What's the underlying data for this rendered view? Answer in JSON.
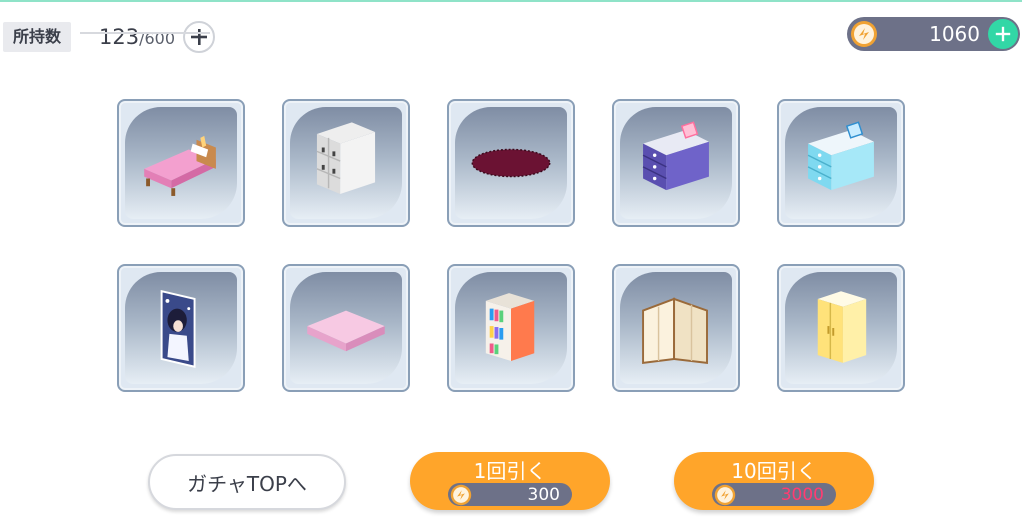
{
  "header": {
    "owned_label": "所持数",
    "owned_current": "123",
    "owned_max": "/600",
    "currency_value": "1060"
  },
  "items": [
    {
      "name": "pink-bed",
      "icon": "bed-icon"
    },
    {
      "name": "white-locker",
      "icon": "locker-icon"
    },
    {
      "name": "oval-rug",
      "icon": "rug-icon"
    },
    {
      "name": "purple-chest",
      "icon": "dresser-icon"
    },
    {
      "name": "blue-chest",
      "icon": "dresser-icon"
    },
    {
      "name": "idol-poster",
      "icon": "poster-icon"
    },
    {
      "name": "pink-mat",
      "icon": "mat-icon"
    },
    {
      "name": "bookshelf",
      "icon": "bookshelf-icon"
    },
    {
      "name": "folding-screen",
      "icon": "screen-icon"
    },
    {
      "name": "yellow-wardrobe",
      "icon": "wardrobe-icon"
    }
  ],
  "buttons": {
    "gacha_top": "ガチャTOPへ",
    "draw1_label": "1回引く",
    "draw1_cost": "300",
    "draw10_label": "10回引く",
    "draw10_cost": "3000"
  },
  "colors": {
    "accent_green": "#32d7a6",
    "button_orange": "#ffa52a",
    "cost_insufficient": "#ff3d72"
  }
}
